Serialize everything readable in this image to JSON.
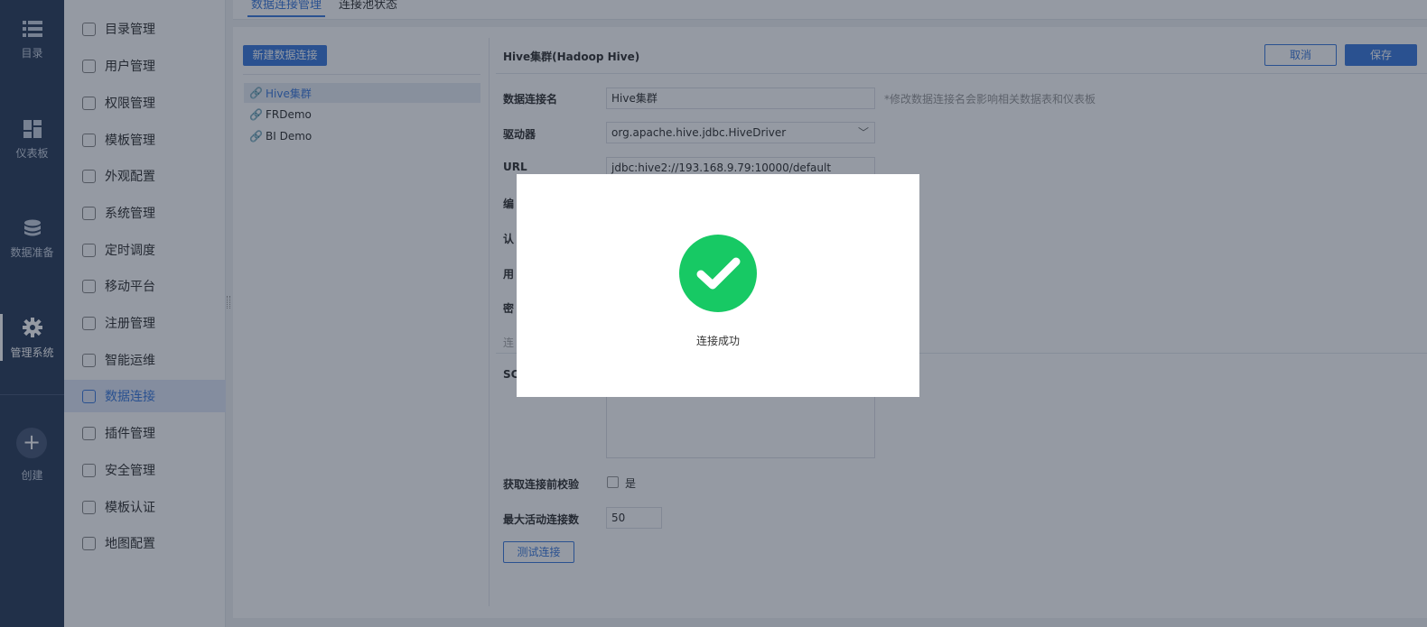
{
  "rail": {
    "items": [
      {
        "label": "目录",
        "icon": "list-icon"
      },
      {
        "label": "仪表板",
        "icon": "dashboard-icon"
      },
      {
        "label": "数据准备",
        "icon": "database-icon"
      },
      {
        "label": "管理系统",
        "icon": "gear-icon",
        "active": true
      },
      {
        "label": "创建",
        "icon": "plus-icon"
      }
    ]
  },
  "menu": {
    "items": [
      {
        "label": "目录管理"
      },
      {
        "label": "用户管理"
      },
      {
        "label": "权限管理"
      },
      {
        "label": "模板管理"
      },
      {
        "label": "外观配置"
      },
      {
        "label": "系统管理"
      },
      {
        "label": "定时调度"
      },
      {
        "label": "移动平台"
      },
      {
        "label": "注册管理"
      },
      {
        "label": "智能运维"
      },
      {
        "label": "数据连接",
        "active": true
      },
      {
        "label": "插件管理"
      },
      {
        "label": "安全管理"
      },
      {
        "label": "模板认证"
      },
      {
        "label": "地图配置"
      }
    ]
  },
  "tabs": [
    {
      "label": "数据连接管理",
      "active": true
    },
    {
      "label": "连接池状态"
    }
  ],
  "connections": {
    "new_button": "新建数据连接",
    "items": [
      {
        "label": "Hive集群",
        "active": true
      },
      {
        "label": "FRDemo"
      },
      {
        "label": "BI Demo"
      }
    ]
  },
  "form": {
    "title": "Hive集群(Hadoop Hive)",
    "cancel": "取消",
    "save": "保存",
    "name_label": "数据连接名",
    "name_value": "Hive集群",
    "name_hint": "*修改数据连接名会影响相关数据表和仪表板",
    "driver_label": "驱动器",
    "driver_value": "org.apache.hive.jdbc.HiveDriver",
    "url_label": "URL",
    "url_value": "jdbc:hive2://193.168.9.79:10000/default",
    "partial_labels": [
      "编",
      "认",
      "用",
      "密",
      "连",
      "SC"
    ],
    "precheck_label": "获取连接前校验",
    "precheck_option": "是",
    "max_active_label": "最大活动连接数",
    "max_active_value": "50",
    "test_button": "测试连接"
  },
  "dialog": {
    "message": "连接成功",
    "icon": "check-circle-icon",
    "color": "#17c964"
  },
  "colors": {
    "accent": "#3d7bdc",
    "rail_bg": "#2c3e5c"
  }
}
